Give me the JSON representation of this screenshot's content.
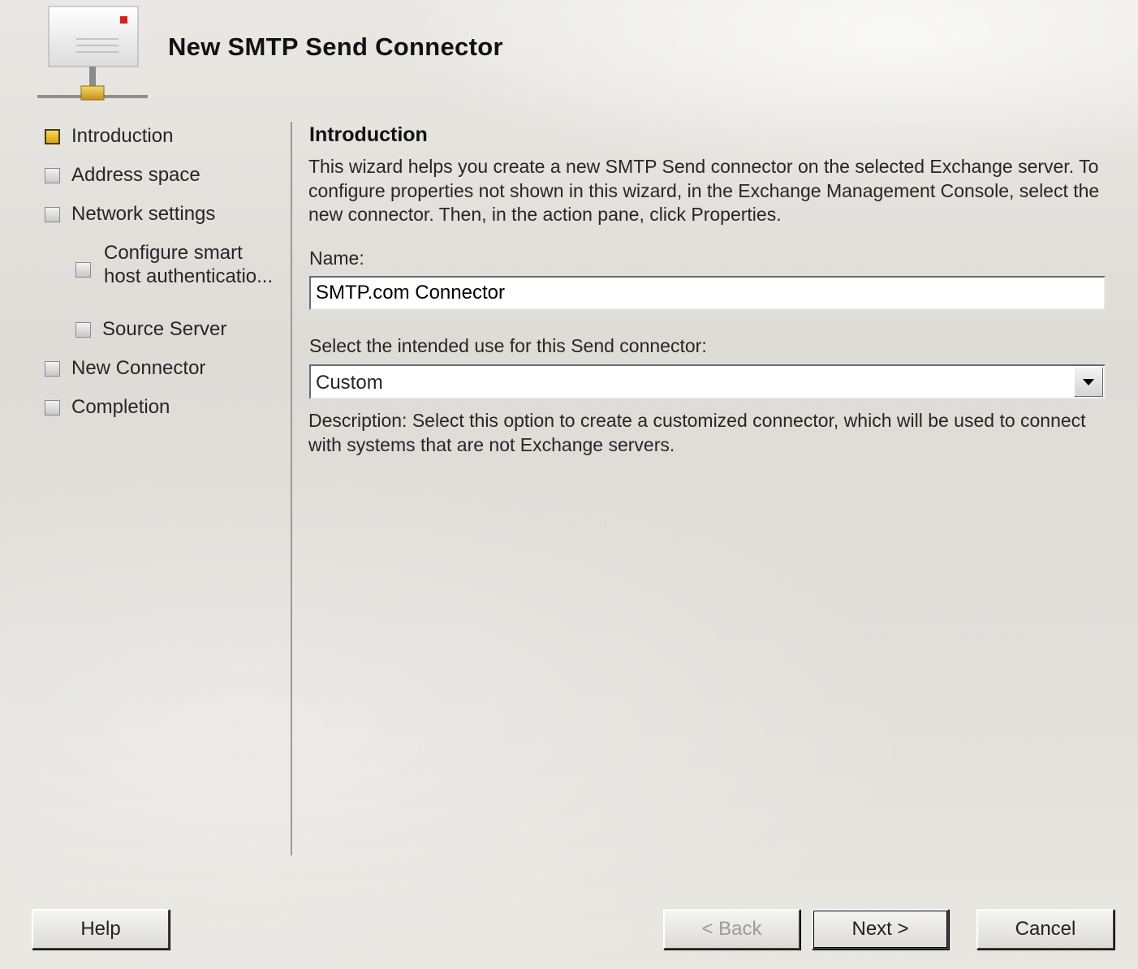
{
  "wizard": {
    "title": "New SMTP Send Connector"
  },
  "steps": [
    {
      "label": "Introduction",
      "active": true
    },
    {
      "label": "Address space",
      "active": false
    },
    {
      "label": "Network settings",
      "active": false
    },
    {
      "label_line1": "Configure smart",
      "label_line2": "host authenticatio...",
      "active": false,
      "sub": true
    },
    {
      "label": "Source Server",
      "active": false,
      "sub": true
    },
    {
      "label": "New Connector",
      "active": false
    },
    {
      "label": "Completion",
      "active": false
    }
  ],
  "content": {
    "section_title": "Introduction",
    "intro_text": "This wizard helps you create a new SMTP Send connector on the selected Exchange server. To configure properties not shown in this wizard, in the Exchange Management Console, select the new connector. Then, in the action pane, click Properties.",
    "name_label": "Name:",
    "name_value": "SMTP.com Connector",
    "use_label": "Select the intended use for this Send connector:",
    "use_value": "Custom",
    "description": "Description: Select this option to create a customized connector, which will be used to connect with systems that are not Exchange servers."
  },
  "buttons": {
    "help": "Help",
    "back": "< Back",
    "next": "Next >",
    "cancel": "Cancel"
  },
  "colors": {
    "active_step": "#e3b52a",
    "background": "#e2e0db"
  }
}
